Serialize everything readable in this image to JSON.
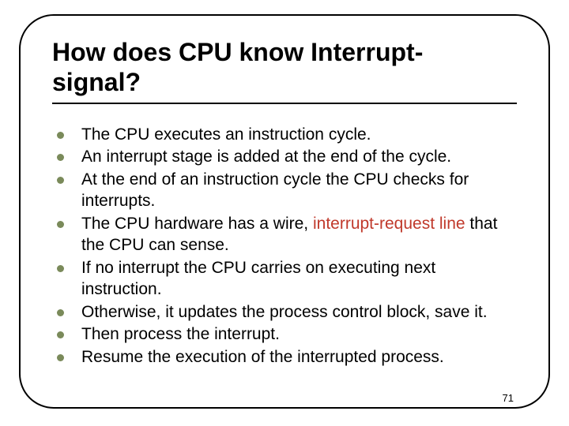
{
  "title_line1": "How does CPU know Interrupt-",
  "title_line2": "signal?",
  "bullets": [
    {
      "pre": "The CPU executes an instruction cycle.",
      "hl": "",
      "post": ""
    },
    {
      "pre": "An interrupt stage is added at the end of the cycle.",
      "hl": "",
      "post": ""
    },
    {
      "pre": "At the end of an instruction cycle the CPU checks for interrupts.",
      "hl": "",
      "post": ""
    },
    {
      "pre": "The CPU hardware has a wire, ",
      "hl": "interrupt-request line",
      "post": " that the CPU can sense."
    },
    {
      "pre": "If no interrupt the CPU carries on executing next instruction.",
      "hl": "",
      "post": ""
    },
    {
      "pre": "Otherwise, it updates the process control block, save it.",
      "hl": "",
      "post": ""
    },
    {
      "pre": "Then process the interrupt.",
      "hl": "",
      "post": ""
    },
    {
      "pre": "Resume the execution of the interrupted process.",
      "hl": "",
      "post": ""
    }
  ],
  "page_number": "71"
}
